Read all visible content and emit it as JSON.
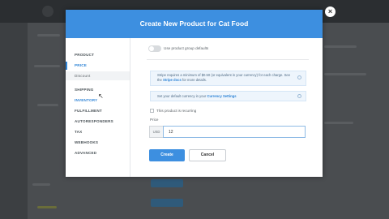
{
  "modal": {
    "title": "Create New Product for Cat Food",
    "close_icon": "×"
  },
  "nav": {
    "items": [
      {
        "label": "PRODUCT",
        "state": "normal"
      },
      {
        "label": "PRICE",
        "state": "active"
      },
      {
        "label": "Discount",
        "state": "sub"
      },
      {
        "label": "SHIPPING",
        "state": "normal"
      },
      {
        "label": "INVENTORY",
        "state": "hover"
      },
      {
        "label": "FULFILLMENT",
        "state": "normal"
      },
      {
        "label": "AUTORESPONDERS",
        "state": "normal"
      },
      {
        "label": "TAX",
        "state": "normal"
      },
      {
        "label": "WEBHOOKS",
        "state": "normal"
      },
      {
        "label": "ADVANCED",
        "state": "normal"
      }
    ]
  },
  "form": {
    "toggle_label": "Use product group defaults",
    "note1": {
      "text_before": "Stripe requires a minimum of $0.50 (or equivalent in your currency) for each charge. See the ",
      "link": "Stripe docs",
      "text_after": " for more details."
    },
    "note2": {
      "text_before": "Set your default currency in your ",
      "link": "Currency Settings"
    },
    "recurring_label": "This product is recurring",
    "price_label": "Price",
    "currency": "USD",
    "price_value": "12"
  },
  "buttons": {
    "create": "Create",
    "cancel": "Cancel"
  },
  "colors": {
    "accent": "#3d8fe0",
    "header": "#3d8fe0"
  }
}
